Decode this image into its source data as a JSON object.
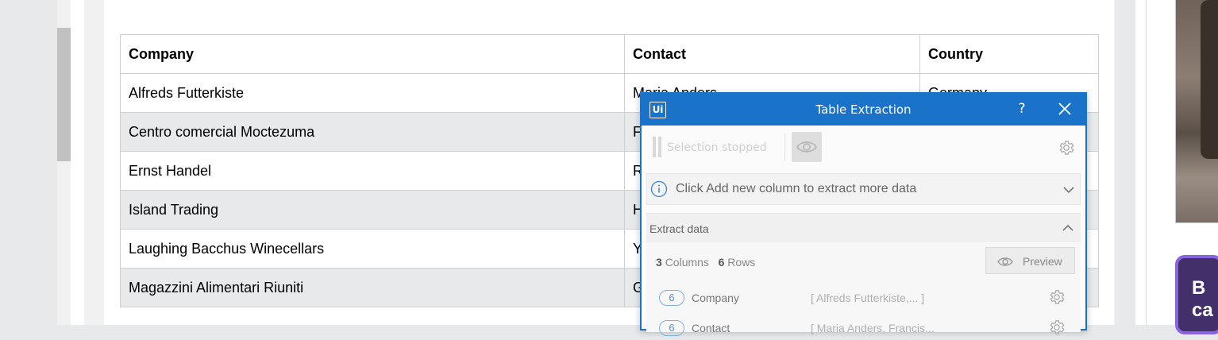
{
  "table": {
    "headers": [
      "Company",
      "Contact",
      "Country"
    ],
    "rows": [
      [
        "Alfreds Futterkiste",
        "Maria Anders",
        "Germany"
      ],
      [
        "Centro comercial Moctezuma",
        "F",
        ""
      ],
      [
        "Ernst Handel",
        "R",
        ""
      ],
      [
        "Island Trading",
        "H",
        ""
      ],
      [
        "Laughing Bacchus Winecellars",
        "Y",
        ""
      ],
      [
        "Magazzini Alimentari Riuniti",
        "G",
        ""
      ]
    ]
  },
  "promo": {
    "line1": "B",
    "line2": "ca"
  },
  "dialog": {
    "logo": "Ui",
    "title": "Table Extraction",
    "help": "?",
    "toolbar": {
      "status": "Selection stopped"
    },
    "info": {
      "text": "Click Add new column to extract more data"
    },
    "extract": {
      "title": "Extract data",
      "columns_count": "3",
      "columns_label": "Columns",
      "rows_count": "6",
      "rows_label": "Rows",
      "preview_label": "Preview",
      "columns": [
        {
          "count": "6",
          "name": "Company",
          "preview": "[ Alfreds Futterkiste,...   ]"
        },
        {
          "count": "6",
          "name": "Contact",
          "preview": "[ Maria Anders, Francis..."
        }
      ]
    }
  },
  "colors": {
    "dialog_accent": "#1a73c9",
    "row_stripe": "#e7e9eb",
    "promo_border": "#8a63e0"
  }
}
